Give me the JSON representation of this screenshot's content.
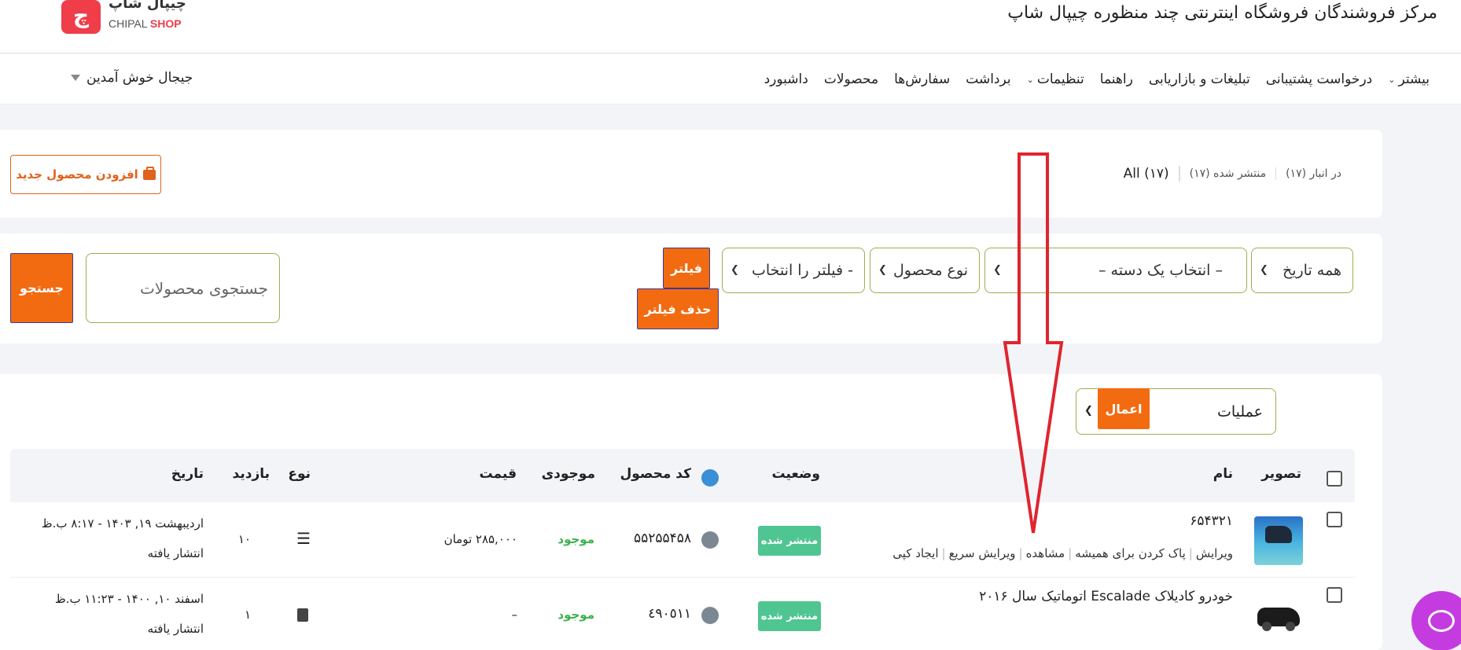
{
  "header": {
    "site_title": "مرکز فروشندگان فروشگاه اینترنتی چند منظوره چیپال شاپ",
    "logo_fa": "چیپال شاپ",
    "logo_en_a": "CHIPAL",
    "logo_en_b": "SHOP",
    "logo_mark": "چ"
  },
  "nav": {
    "items": [
      "داشبورد",
      "محصولات",
      "سفارش‌ها",
      "برداشت",
      "تنظیمات",
      "راهنما",
      "تبلیغات و بازاریابی",
      "درخواست پشتیبانی",
      "بیشتر"
    ],
    "user_greeting": "جیجال خوش آمدین"
  },
  "status": {
    "all": "All (۱۷)",
    "published": "منتشر شده (۱۷)",
    "in_stock": "در انبار (۱۷)"
  },
  "add_product_label": "افزودن محصول جدید",
  "filters": {
    "date": "همه تاریخ",
    "category": "– انتخاب یک دسته –",
    "product_type": "نوع محصول",
    "filter_select": "- فیلتر را انتخاب",
    "filter_button": "فیلتر",
    "remove_filter_button": "حذف فیلتر",
    "search_placeholder": "جستجوی محصولات",
    "search_button": "جستجو"
  },
  "bulk": {
    "actions_label": "عملیات",
    "apply_button": "اعمال"
  },
  "table": {
    "headers": {
      "image": "تصویر",
      "name": "نام",
      "status": "وضعیت",
      "sku": "کد محصول",
      "stock": "موجودی",
      "price": "قیمت",
      "type": "نوع",
      "views": "بازدید",
      "date": "تاریخ"
    },
    "rows": [
      {
        "name": "۶۵۴۳۲۱",
        "actions": [
          "ویرایش",
          "پاک کردن برای همیشه",
          "مشاهده",
          "ویرایش سریع",
          "ایجاد کپی"
        ],
        "status": "منتشر شده",
        "sku": "۵۵۲۵۵۴۵۸",
        "stock": "موجود",
        "price": "۲۸۵,۰۰۰ تومان",
        "type_icon": "list-icon",
        "views": "۱۰",
        "date": "اردیبهشت ۱۹, ۱۴۰۳ - ۸:۱۷ ب.ظ",
        "date_status": "انتشار یافته"
      },
      {
        "name": "خودرو کادیلاک Escalade اتوماتیک سال ۲۰۱۶",
        "actions": [],
        "status": "منتشر شده",
        "sku": "٤٩٠٥١١",
        "stock": "موجود",
        "price": "–",
        "type_icon": "book-icon",
        "views": "۱",
        "date": "اسفند ۱۰, ۱۴۰۰ - ۱۱:۲۳ ب.ظ",
        "date_status": "انتشار یافته"
      }
    ]
  },
  "colors": {
    "accent_orange": "#f26b11",
    "published_green": "#4fc592",
    "annotation_red": "#e0242e",
    "chat_purple": "#c43be0"
  }
}
